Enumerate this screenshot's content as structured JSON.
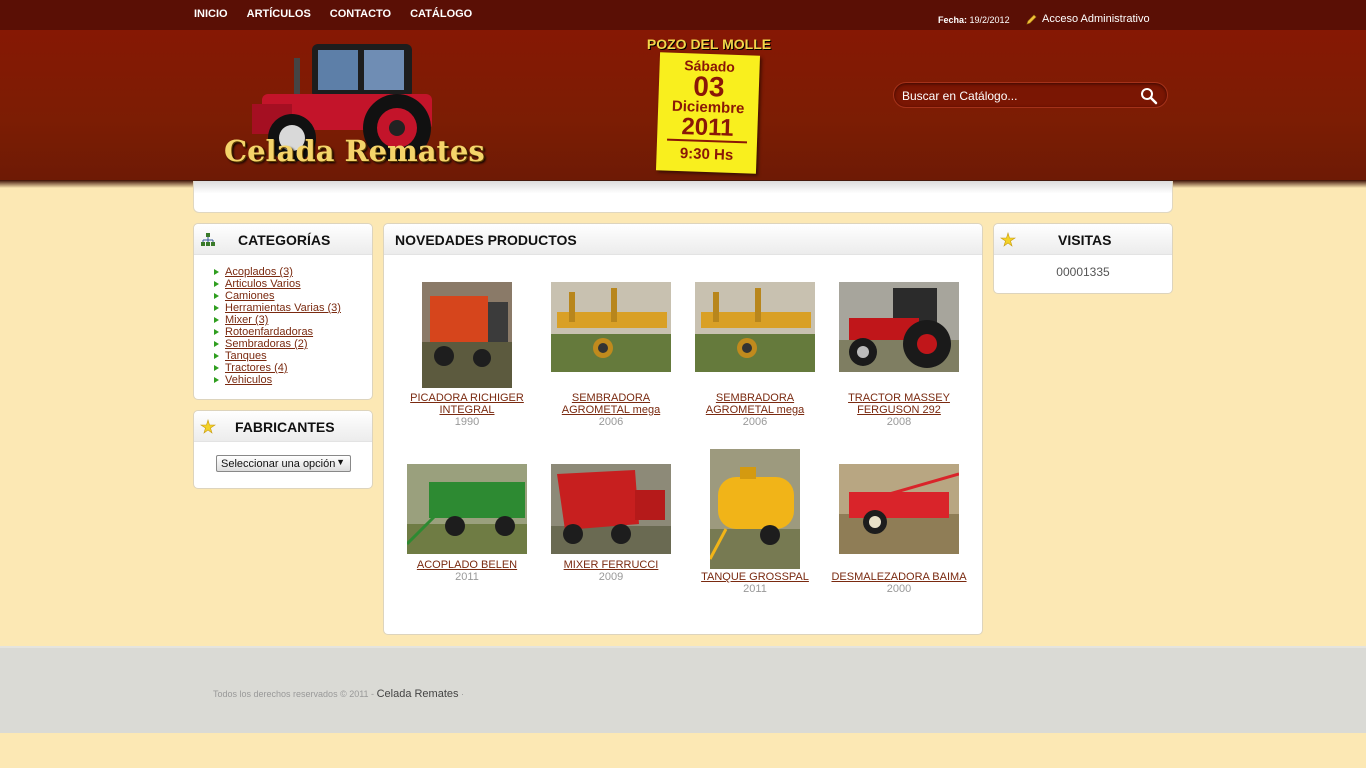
{
  "nav": {
    "items": [
      "INICIO",
      "ARTÍCULOS",
      "CONTACTO",
      "CATÁLOGO"
    ]
  },
  "topinfo": {
    "date_label": "Fecha:",
    "date_value": "19/2/2012",
    "admin_label": "Acceso Administrativo"
  },
  "brand": {
    "name": "Celada Remates"
  },
  "event": {
    "place": "POZO DEL MOLLE",
    "day_name": "Sábado",
    "day": "03",
    "month": "Diciembre",
    "year": "2011",
    "time": "9:30 Hs"
  },
  "search": {
    "placeholder": "Buscar en Catálogo..."
  },
  "categories": {
    "title": "CATEGORÍAS",
    "items": [
      "Acoplados (3)",
      "Articulos Varios",
      "Camiones",
      "Herramientas Varias (3)",
      "Mixer (3)",
      "Rotoenfardadoras",
      "Sembradoras (2)",
      "Tanques",
      "Tractores (4)",
      "Vehiculos"
    ]
  },
  "manufacturers": {
    "title": "FABRICANTES",
    "select_value": "Seleccionar una opción"
  },
  "products": {
    "title": "NOVEDADES PRODUCTOS",
    "items": [
      {
        "name": "PICADORA RICHIGER INTEGRAL",
        "year": "1990"
      },
      {
        "name": "SEMBRADORA AGROMETAL mega",
        "year": "2006"
      },
      {
        "name": "SEMBRADORA AGROMETAL mega",
        "year": "2006"
      },
      {
        "name": "TRACTOR MASSEY FERGUSON 292",
        "year": "2008"
      },
      {
        "name": "ACOPLADO BELEN",
        "year": "2011"
      },
      {
        "name": "MIXER FERRUCCI",
        "year": "2009"
      },
      {
        "name": "TANQUE GROSSPAL",
        "year": "2011"
      },
      {
        "name": "DESMALEZADORA BAIMA",
        "year": "2000"
      }
    ]
  },
  "visits": {
    "title": "VISITAS",
    "count": "00001335"
  },
  "footer": {
    "text": "Todos los derechos reservados © 2011 -",
    "brand": "Celada Remates",
    "tail": "·"
  },
  "colors": {
    "header": "#7c1d04",
    "topbar": "#5a0f05",
    "page": "#fce8b4",
    "link": "#7a2a10"
  }
}
